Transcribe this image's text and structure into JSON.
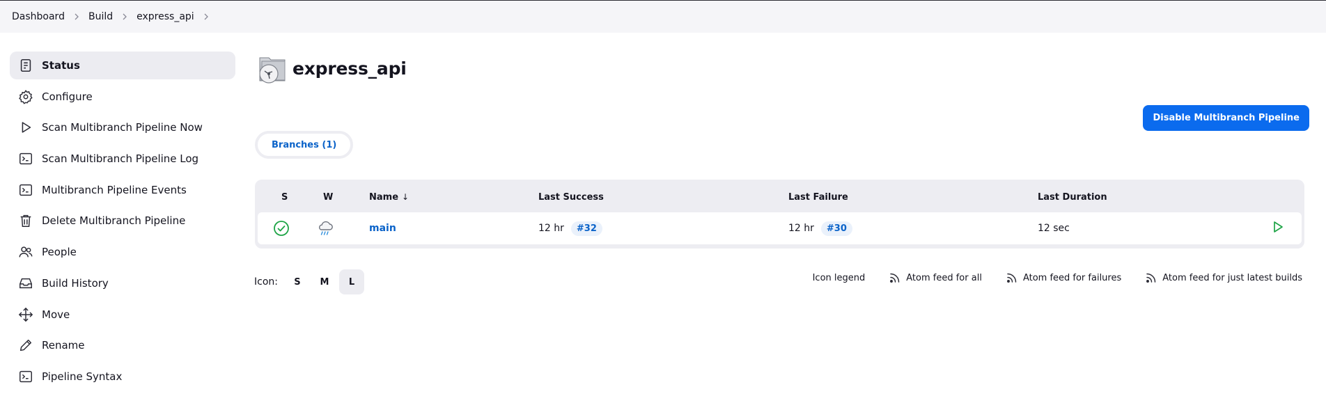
{
  "breadcrumb": {
    "items": [
      "Dashboard",
      "Build",
      "express_api"
    ]
  },
  "sidebar": {
    "items": [
      {
        "label": "Status",
        "icon": "document-icon",
        "active": true
      },
      {
        "label": "Configure",
        "icon": "gear-icon"
      },
      {
        "label": "Scan Multibranch Pipeline Now",
        "icon": "play-icon"
      },
      {
        "label": "Scan Multibranch Pipeline Log",
        "icon": "terminal-icon"
      },
      {
        "label": "Multibranch Pipeline Events",
        "icon": "terminal-icon"
      },
      {
        "label": "Delete Multibranch Pipeline",
        "icon": "trash-icon"
      },
      {
        "label": "People",
        "icon": "people-icon"
      },
      {
        "label": "Build History",
        "icon": "inbox-icon"
      },
      {
        "label": "Move",
        "icon": "move-icon"
      },
      {
        "label": "Rename",
        "icon": "pencil-icon"
      },
      {
        "label": "Pipeline Syntax",
        "icon": "terminal-icon"
      }
    ]
  },
  "header": {
    "title": "express_api",
    "icon": "folder-icon"
  },
  "actions": {
    "disable_label": "Disable Multibranch Pipeline"
  },
  "tabs": [
    {
      "label": "Branches (1)"
    }
  ],
  "table": {
    "columns": {
      "s": "S",
      "w": "W",
      "name": "Name",
      "sort_arrow": "↓",
      "last_success": "Last Success",
      "last_failure": "Last Failure",
      "last_duration": "Last Duration"
    },
    "rows": [
      {
        "status_icon": "success-check-icon",
        "weather_icon": "rain-cloud-icon",
        "name": "main",
        "last_success_time": "12 hr",
        "last_success_build": "#32",
        "last_failure_time": "12 hr",
        "last_failure_build": "#30",
        "last_duration": "12 sec",
        "run_icon": "play-icon"
      }
    ]
  },
  "icon_size": {
    "label": "Icon:",
    "options": [
      "S",
      "M",
      "L"
    ],
    "selected": "L"
  },
  "footer": {
    "icon_legend": "Icon legend",
    "feeds": [
      "Atom feed for all",
      "Atom feed for failures",
      "Atom feed for just latest builds"
    ]
  },
  "colors": {
    "accent": "#0b6bee",
    "link": "#0b63c9",
    "success": "#1ea446",
    "sidebar_active": "#ececf1",
    "table_bg": "#ededf2"
  }
}
